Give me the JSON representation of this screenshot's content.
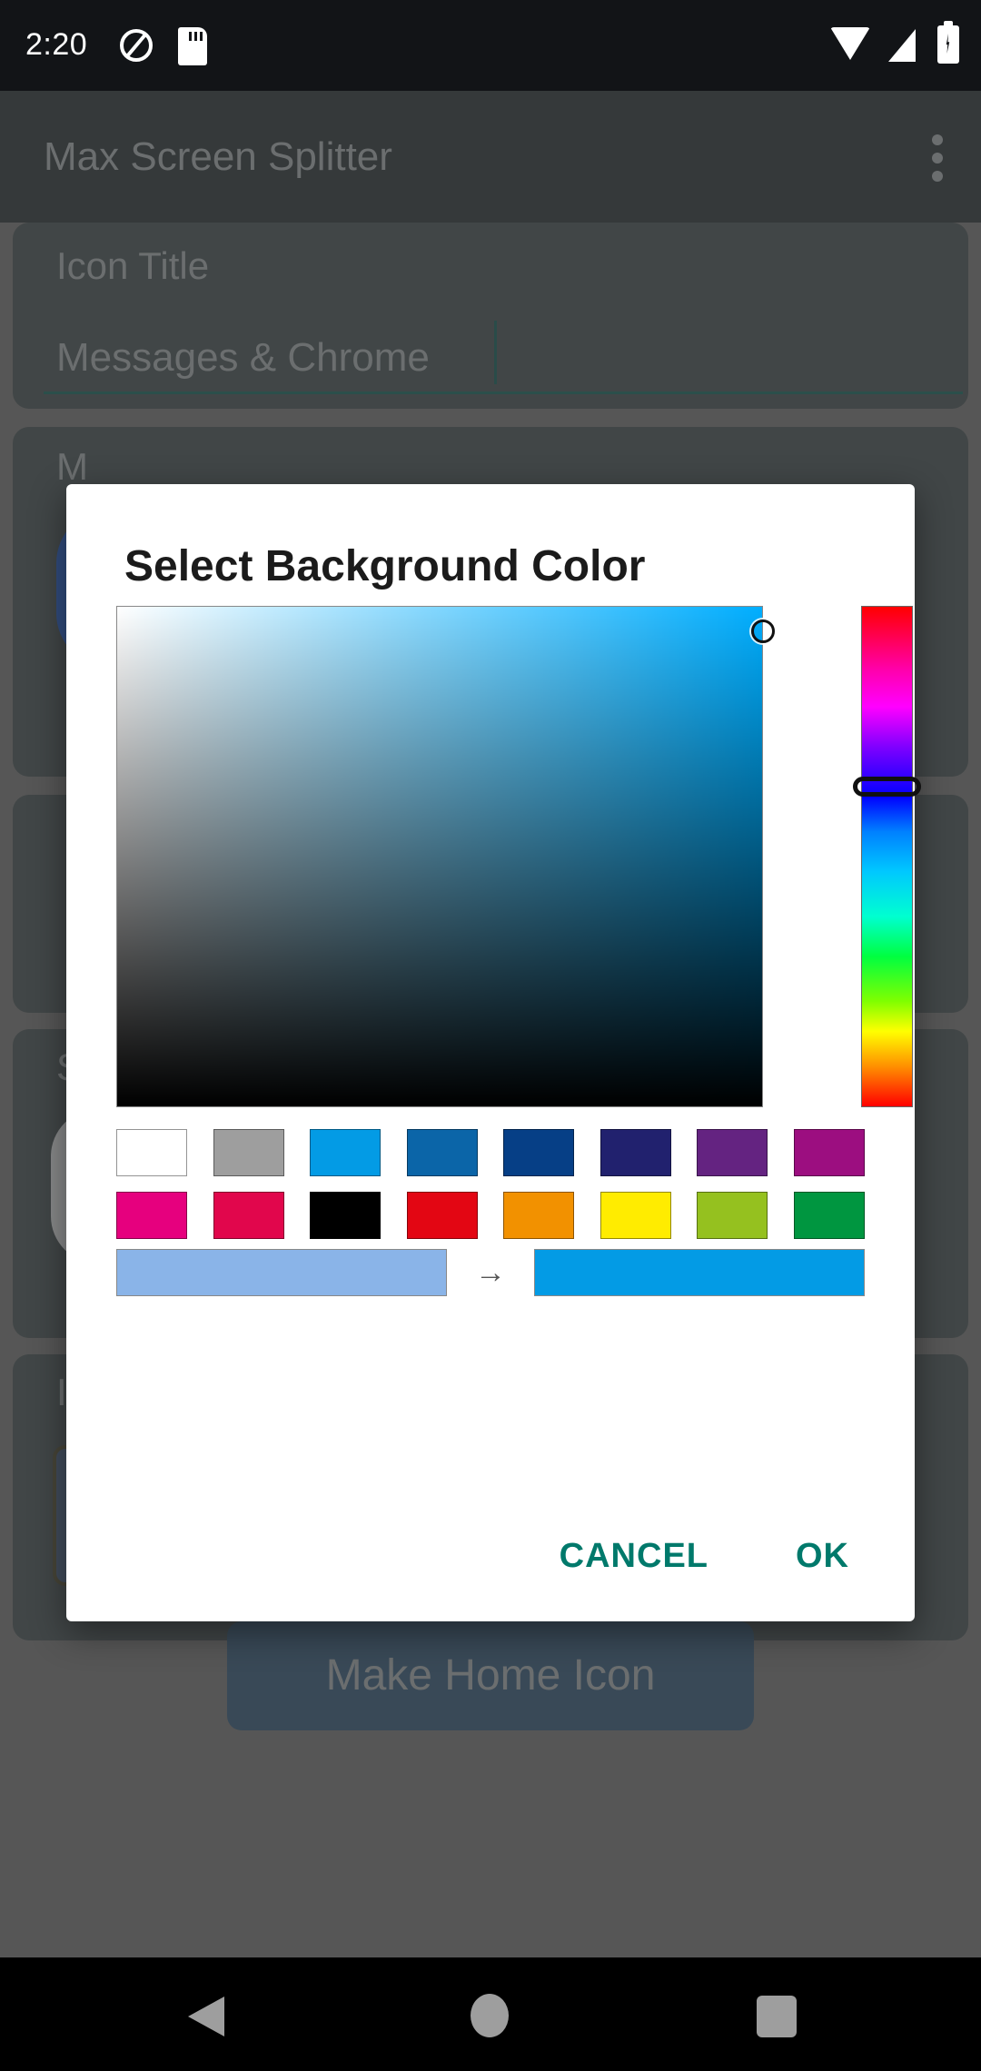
{
  "status_bar": {
    "clock": "2:20",
    "icons": [
      "circle-slash-icon",
      "sd-card-icon",
      "wifi-icon",
      "signal-icon",
      "battery-charging-icon"
    ]
  },
  "app_bar": {
    "title": "Max Screen Splitter",
    "overflow_icon": "more-vert-icon"
  },
  "background": {
    "icon_title_label": "Icon Title",
    "icon_title_value": "Messages & Chrome",
    "card_m_label": "M",
    "card_sub_label": "Su",
    "card_ic_label": "Ic",
    "make_home_button": "Make Home Icon"
  },
  "dialog": {
    "title": "Select Background Color",
    "cancel_label": "CANCEL",
    "ok_label": "OK",
    "accent_color": "#00796B",
    "preview_arrow": "→",
    "old_color": "#8ab4e8",
    "new_color": "#039be5",
    "selected_hue_deg": 199,
    "sv_cursor": {
      "saturation": 1.0,
      "value": 0.95
    },
    "hue_thumb_position_pct": 36,
    "swatches": [
      [
        {
          "name": "white",
          "hex": "#ffffff"
        },
        {
          "name": "gray",
          "hex": "#9e9e9e"
        },
        {
          "name": "light-blue",
          "hex": "#039be5"
        },
        {
          "name": "blue",
          "hex": "#0b65a8"
        },
        {
          "name": "dark-blue",
          "hex": "#063f86"
        },
        {
          "name": "navy",
          "hex": "#21216e"
        },
        {
          "name": "purple",
          "hex": "#642381"
        },
        {
          "name": "magenta-purple",
          "hex": "#9c0e80"
        }
      ],
      [
        {
          "name": "pink",
          "hex": "#e6007e"
        },
        {
          "name": "crimson",
          "hex": "#e1064c"
        },
        {
          "name": "black",
          "hex": "#000000"
        },
        {
          "name": "red",
          "hex": "#e30613"
        },
        {
          "name": "orange",
          "hex": "#f29100"
        },
        {
          "name": "yellow",
          "hex": "#ffec00"
        },
        {
          "name": "yellow-green",
          "hex": "#95c11f"
        },
        {
          "name": "green",
          "hex": "#009640"
        }
      ]
    ]
  },
  "nav_bar": {
    "back_label": "back-icon",
    "home_label": "home-icon",
    "recents_label": "recents-icon"
  }
}
